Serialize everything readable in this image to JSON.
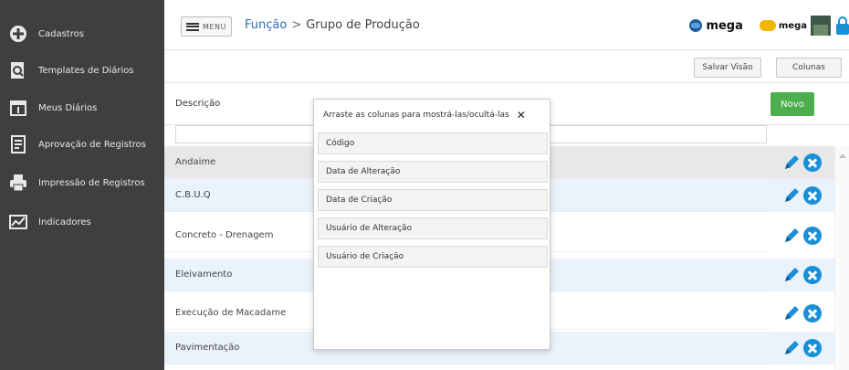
{
  "sidebar": {
    "items": [
      {
        "label": "Cadastros",
        "icon": "plus-circle-icon"
      },
      {
        "label": "Templates de Diários",
        "icon": "document-search-icon"
      },
      {
        "label": "Meus Diários",
        "icon": "calendar-icon"
      },
      {
        "label": "Aprovação de Registros",
        "icon": "checklist-icon"
      },
      {
        "label": "Impressão de Registros",
        "icon": "printer-icon"
      },
      {
        "label": "Indicadores",
        "icon": "chart-icon"
      }
    ]
  },
  "header": {
    "menu_label": "MENU",
    "breadcrumb": [
      "Função",
      "Grupo de Produção"
    ],
    "breadcrumb_sep": ">",
    "logo1_text": "mega",
    "logo2_text": "mega"
  },
  "toolbar": {
    "save_view_label": "Salvar Visão",
    "columns_label": "Colunas"
  },
  "table": {
    "column_header": "Descrição",
    "new_button_label": "Novo",
    "rows": [
      "Andaime",
      "C.B.U.Q",
      "Concreto - Drenagem",
      "Eleivamento",
      "Execução de Macadame",
      "Pavimentação"
    ]
  },
  "column_chooser": {
    "title": "Arraste as colunas para mostrá-las/ocultá-las",
    "close_glyph": "✕",
    "columns": [
      "Código",
      "Data de Alteração",
      "Data de Criação",
      "Usuário de Alteração",
      "Usuário de Criação"
    ]
  },
  "colors": {
    "sidebar_bg": "#3f3f3f",
    "accent_blue": "#1a8fd8",
    "new_button_green": "#4cae4c",
    "row_alt": "#eaf2fb",
    "row_selected": "#e8e8e8"
  }
}
